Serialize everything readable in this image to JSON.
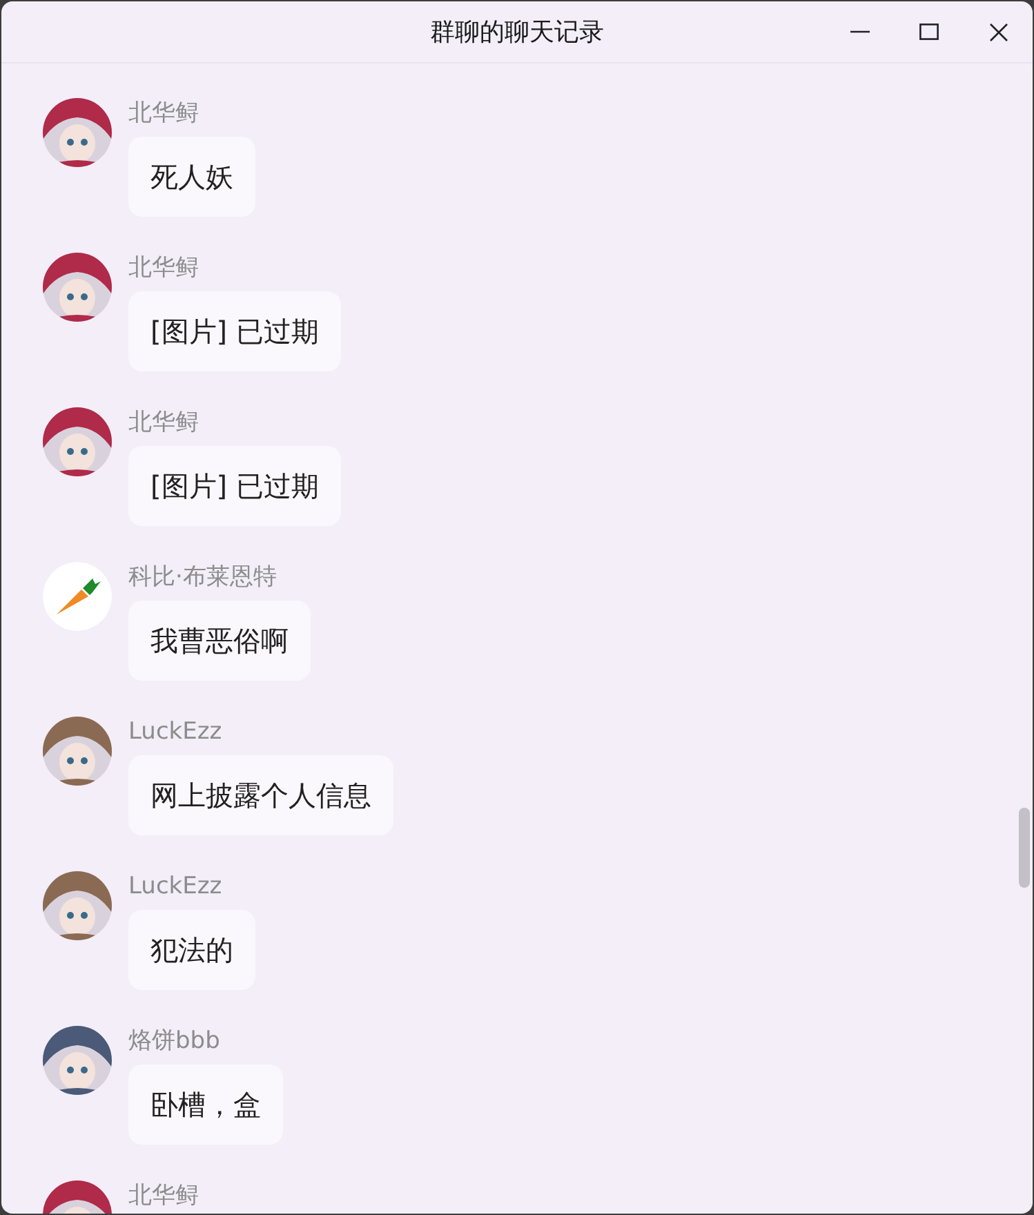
{
  "window": {
    "title": "群聊的聊天记录"
  },
  "messages": [
    {
      "sender": "北华鲟",
      "text": "死人妖"
    },
    {
      "sender": "北华鲟",
      "text": "[图片] 已过期"
    },
    {
      "sender": "北华鲟",
      "text": "[图片] 已过期"
    },
    {
      "sender": "科比·布莱恩特",
      "text": "我曹恶俗啊",
      "avatar": {
        "kind": "carrot"
      }
    },
    {
      "sender": "LuckEzz",
      "text": "网上披露个人信息"
    },
    {
      "sender": "LuckEzz",
      "text": "犯法的"
    },
    {
      "sender": "烙饼bbb",
      "text": "卧槽，盒"
    },
    {
      "sender": "北华鲟"
    }
  ]
}
